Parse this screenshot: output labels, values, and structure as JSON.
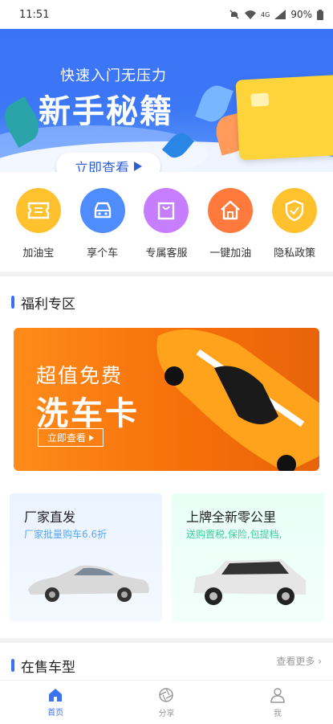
{
  "status": {
    "time": "11:51",
    "network": "4G",
    "battery": "90%"
  },
  "banner": {
    "subtitle": "快速入门无压力",
    "title": "新手秘籍",
    "button": "立即查看"
  },
  "menu": [
    {
      "label": "加油宝",
      "icon": "ticket-icon",
      "color": "#ffc12d"
    },
    {
      "label": "享个车",
      "icon": "car-icon",
      "color": "#4f8dff"
    },
    {
      "label": "专属客服",
      "icon": "bag-icon",
      "color": "#c77dff"
    },
    {
      "label": "一键加油",
      "icon": "home-icon",
      "color": "#ff7a3c"
    },
    {
      "label": "隐私政策",
      "icon": "shield-icon",
      "color": "#ffc12d"
    }
  ],
  "welfare": {
    "title": "福利专区",
    "wash": {
      "subtitle": "超值免费",
      "title": "洗车卡",
      "button": "立即查看"
    },
    "cards": [
      {
        "title": "厂家直发",
        "sub": "厂家批量购车6.6折",
        "sub_color": "#5aa6ff"
      },
      {
        "title": "上牌全新零公里",
        "sub": "送购置税,保险,包提档,",
        "sub_color": "#3ccf9c"
      }
    ]
  },
  "onsale": {
    "title": "在售车型",
    "more": "查看更多"
  },
  "tabs": [
    {
      "label": "首页",
      "active": true
    },
    {
      "label": "分享",
      "active": false
    },
    {
      "label": "我",
      "active": false
    }
  ]
}
